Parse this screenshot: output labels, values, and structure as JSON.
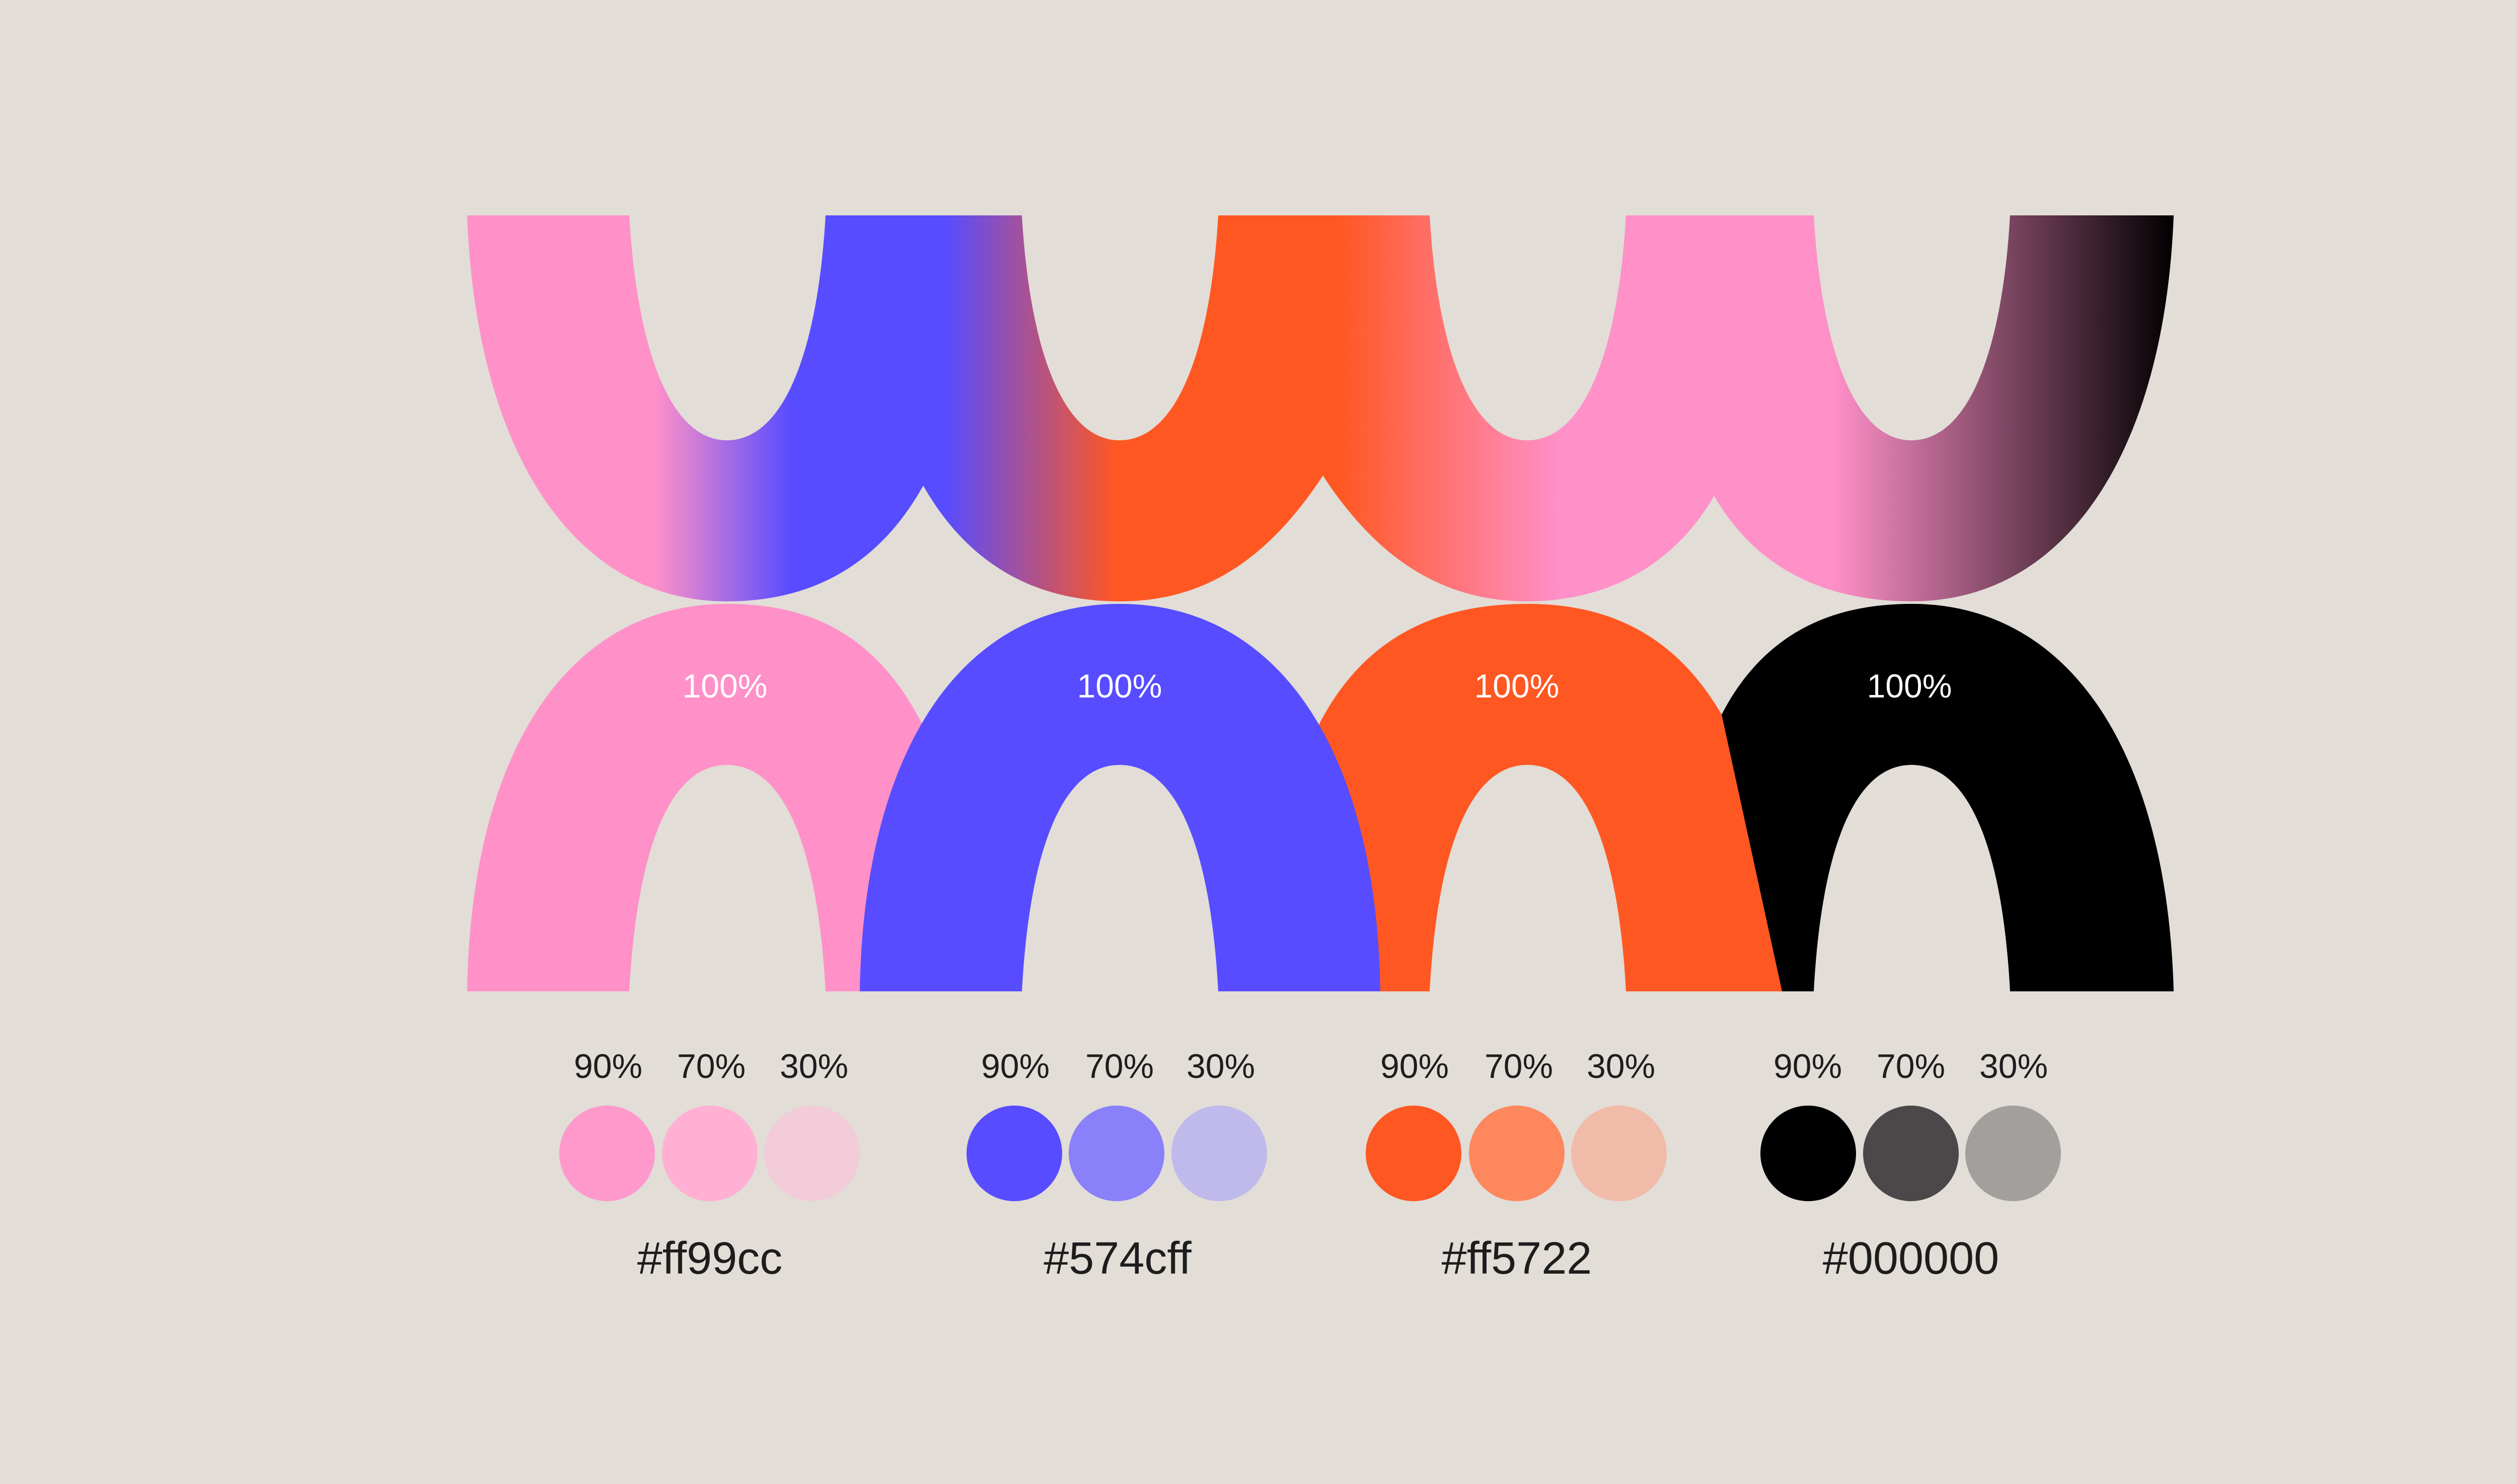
{
  "palette": [
    {
      "hex": "#ff99cc",
      "top_label": "100%",
      "shades": [
        {
          "label": "90%",
          "color": "#ff99cc"
        },
        {
          "label": "70%",
          "color": "#ffb0d3"
        },
        {
          "label": "30%",
          "color": "#f2ccd8"
        }
      ]
    },
    {
      "hex": "#574cff",
      "top_label": "100%",
      "shades": [
        {
          "label": "90%",
          "color": "#574cff"
        },
        {
          "label": "70%",
          "color": "#8a80fa"
        },
        {
          "label": "30%",
          "color": "#bfbaeb"
        }
      ]
    },
    {
      "hex": "#ff5722",
      "top_label": "100%",
      "shades": [
        {
          "label": "90%",
          "color": "#ff5722"
        },
        {
          "label": "70%",
          "color": "#ff875d"
        },
        {
          "label": "30%",
          "color": "#f0bba8"
        }
      ]
    },
    {
      "hex": "#000000",
      "top_label": "100%",
      "shades": [
        {
          "label": "90%",
          "color": "#000000"
        },
        {
          "label": "70%",
          "color": "#4a4848"
        },
        {
          "label": "30%",
          "color": "#a2a09d"
        }
      ]
    }
  ],
  "colors": {
    "background": "#e2ddd7",
    "text": "#1d1d1d"
  }
}
